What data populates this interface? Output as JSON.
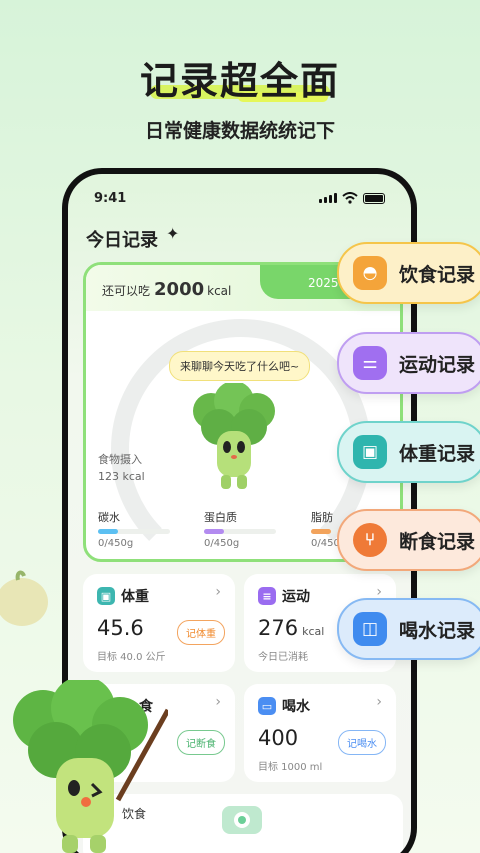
{
  "hero": {
    "title": "记录超全面",
    "subtitle": "日常健康数据统统记下"
  },
  "status_bar": {
    "time": "9:41"
  },
  "page": {
    "title": "今日记录"
  },
  "summary": {
    "remaining_label": "还可以吃",
    "remaining_value": "2000",
    "remaining_unit": "kcal",
    "date": "2025年0",
    "bubble": "来聊聊今天吃了什么吧~",
    "intake_label": "食物摄入",
    "intake_value": "123 kcal",
    "macros": [
      {
        "label": "碳水",
        "value": "0/450g",
        "color": "#5cc0f2"
      },
      {
        "label": "蛋白质",
        "value": "0/450g",
        "color": "#b38bf0"
      },
      {
        "label": "脂肪",
        "value": "0/450",
        "color": "#f2a35c"
      }
    ]
  },
  "tiles": {
    "weight": {
      "title": "体重",
      "value": "45.6",
      "button": "记体重",
      "sub": "目标 40.0 公斤",
      "color": "#3db6b0"
    },
    "exercise": {
      "title": "运动",
      "value": "276",
      "unit": "kcal",
      "sub": "今日已消耗",
      "color": "#9a6cf0"
    },
    "fasting": {
      "title": "食",
      "button": "记断食",
      "color": "#48b26d"
    },
    "water": {
      "title": "喝水",
      "value": "400",
      "button": "记喝水",
      "sub": "目标 1000 ml",
      "color": "#4b8ef2"
    }
  },
  "bottom": {
    "diet_label": "饮食"
  },
  "pills": [
    {
      "label": "饮食记录",
      "icon": "dish-icon",
      "bg": "#fdf0c8",
      "border": "#f5c54a",
      "icon_bg": "#f4a43a"
    },
    {
      "label": "运动记录",
      "icon": "dumbbell-icon",
      "bg": "#efe4fb",
      "border": "#bf9ef1",
      "icon_bg": "#a06ff0"
    },
    {
      "label": "体重记录",
      "icon": "scale-icon",
      "bg": "#d9f4f2",
      "border": "#6fd3cb",
      "icon_bg": "#2fb5ae"
    },
    {
      "label": "断食记录",
      "icon": "fork-spoon-icon",
      "bg": "#fde9dc",
      "border": "#f2a87a",
      "icon_bg": "#ef7a37"
    },
    {
      "label": "喝水记录",
      "icon": "cup-icon",
      "bg": "#dcebfb",
      "border": "#86b9f3",
      "icon_bg": "#3f8bef"
    }
  ]
}
